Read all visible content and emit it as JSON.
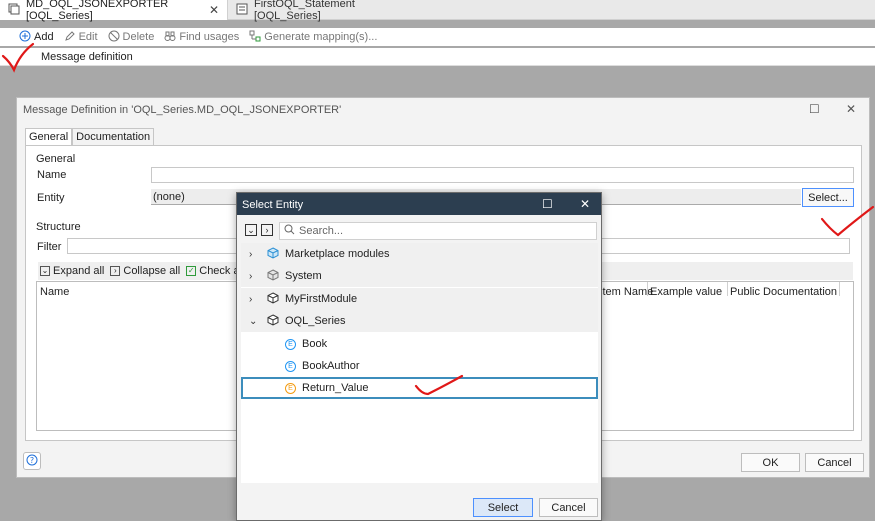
{
  "doc_tabs": [
    {
      "label": "MD_OQL_JSONEXPORTER [OQL_Series]",
      "active": true
    },
    {
      "label": "FirstOQL_Statement [OQL_Series]",
      "active": false
    }
  ],
  "toolbar": {
    "add": "Add",
    "edit": "Edit",
    "delete": "Delete",
    "find_usages": "Find usages",
    "generate_mapping": "Generate mapping(s)..."
  },
  "message_definition_row": "Message definition",
  "main_dialog": {
    "title": "Message Definition in 'OQL_Series.MD_OQL_JSONEXPORTER'",
    "tabs": [
      "General",
      "Documentation"
    ],
    "general_group": "General",
    "name_label": "Name",
    "name_value": "",
    "entity_label": "Entity",
    "entity_value": "(none)",
    "select_button": "Select...",
    "structure_group": "Structure",
    "filter_label": "Filter",
    "tree_toolbar": {
      "expand_all": "Expand all",
      "collapse_all": "Collapse all",
      "check_all": "Check all"
    },
    "columns": [
      "Name",
      "stem Name",
      "Example value",
      "Public Documentation"
    ],
    "ok": "OK",
    "cancel": "Cancel"
  },
  "select_entity": {
    "title": "Select Entity",
    "search_placeholder": "Search...",
    "items": [
      {
        "label": "Marketplace modules",
        "kind": "module",
        "expanded": false
      },
      {
        "label": "System",
        "kind": "module",
        "expanded": false
      },
      {
        "label": "MyFirstModule",
        "kind": "module",
        "expanded": false
      },
      {
        "label": "OQL_Series",
        "kind": "module",
        "expanded": true
      },
      {
        "label": "Book",
        "kind": "entity"
      },
      {
        "label": "BookAuthor",
        "kind": "entity"
      },
      {
        "label": "Return_Value",
        "kind": "entity",
        "selected": true
      }
    ],
    "select_button": "Select",
    "cancel_button": "Cancel"
  },
  "colors": {
    "select_title_bg": "#2c3e50",
    "selection_border": "#3c8dbc",
    "annotation": "#e01818"
  }
}
